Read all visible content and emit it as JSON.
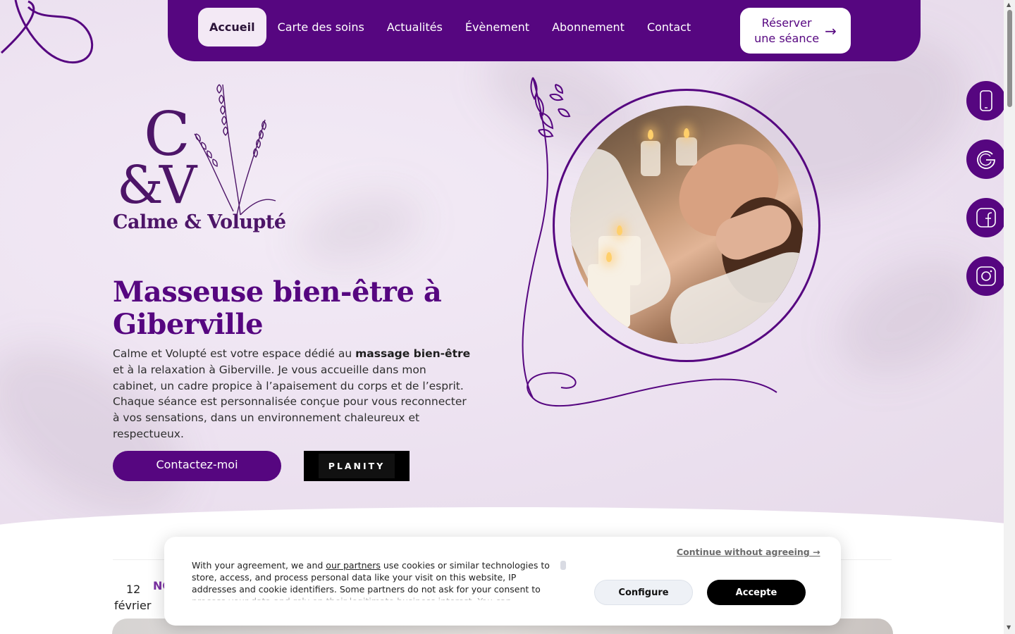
{
  "nav": {
    "items": [
      {
        "label": "Accueil",
        "active": true
      },
      {
        "label": "Carte des soins",
        "active": false
      },
      {
        "label": "Actualités",
        "active": false
      },
      {
        "label": "Évènement",
        "active": false
      },
      {
        "label": "Abonnement",
        "active": false
      },
      {
        "label": "Contact",
        "active": false
      }
    ],
    "reserve_label_line1": "Réserver",
    "reserve_label_line2": "une séance",
    "reserve_arrow": "→"
  },
  "logo": {
    "letter_c": "C",
    "letters_v": "&V",
    "name": "Calme & Volupté"
  },
  "hero": {
    "title": "Masseuse bien-être à Giberville",
    "text_before": "Calme et Volupté est votre espace dédié au ",
    "text_bold": "massage bien-être",
    "text_after": " et à la relaxation à Giberville. Je vous accueille dans mon cabinet, un cadre propice à l’apaisement du corps et de l’esprit. Chaque séance est personnalisée conçue pour vous reconnecter à vos sensations, dans un environnement chaleureux et respectueux.",
    "contact_button": "Contactez-moi",
    "planity_button": "PLANITY"
  },
  "social": [
    {
      "icon": "phone-icon"
    },
    {
      "icon": "google-icon"
    },
    {
      "icon": "facebook-icon"
    },
    {
      "icon": "instagram-icon"
    }
  ],
  "news": {
    "day": "12",
    "month": "février",
    "category_partial": "NO"
  },
  "cookie": {
    "continue_label": "Continue without agreeing →",
    "text_before": "With your agreement, we and ",
    "text_link": "our partners",
    "text_after": " use cookies or similar technologies to store, access, and process personal data like your visit on this website, IP addresses and cookie identifiers. Some partners do not ask for your consent to process your data and rely on their legitimate business interest. You can",
    "configure_label": "Configure",
    "accept_label": "Accepte"
  },
  "colors": {
    "brand_purple": "#560680",
    "hero_bg": "#ece1f0",
    "cookie_accept": "#000000"
  }
}
